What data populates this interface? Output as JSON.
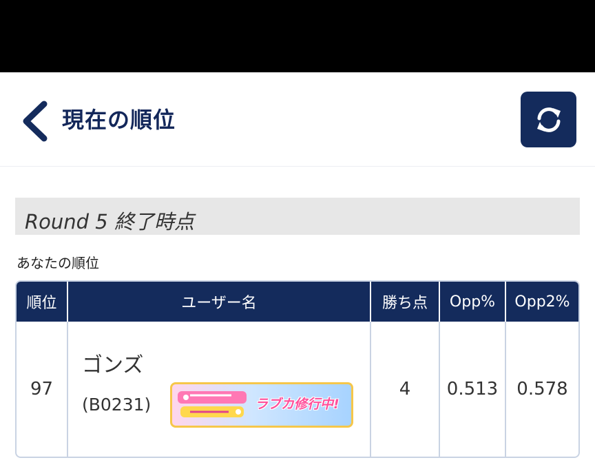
{
  "header": {
    "title": "現在の順位"
  },
  "round": {
    "title": "Round 5 終了時点"
  },
  "section": {
    "your_rank_label": "あなたの順位"
  },
  "table": {
    "columns": [
      "順位",
      "ユーザー名",
      "勝ち点",
      "Opp%",
      "Opp2%"
    ],
    "rows": [
      {
        "rank": "97",
        "user_name": "ゴンズ",
        "user_id": "(B0231)",
        "badge_text": "ラブカ修行中!",
        "points": "4",
        "opp": "0.513",
        "opp2": "0.578"
      }
    ]
  },
  "colors": {
    "navy": "#142b5c",
    "title": "#13275a",
    "border": "#c9d3e3",
    "round_bg": "#e7e7e7"
  },
  "icons": {
    "back": "chevron-left-icon",
    "refresh": "refresh-icon"
  }
}
